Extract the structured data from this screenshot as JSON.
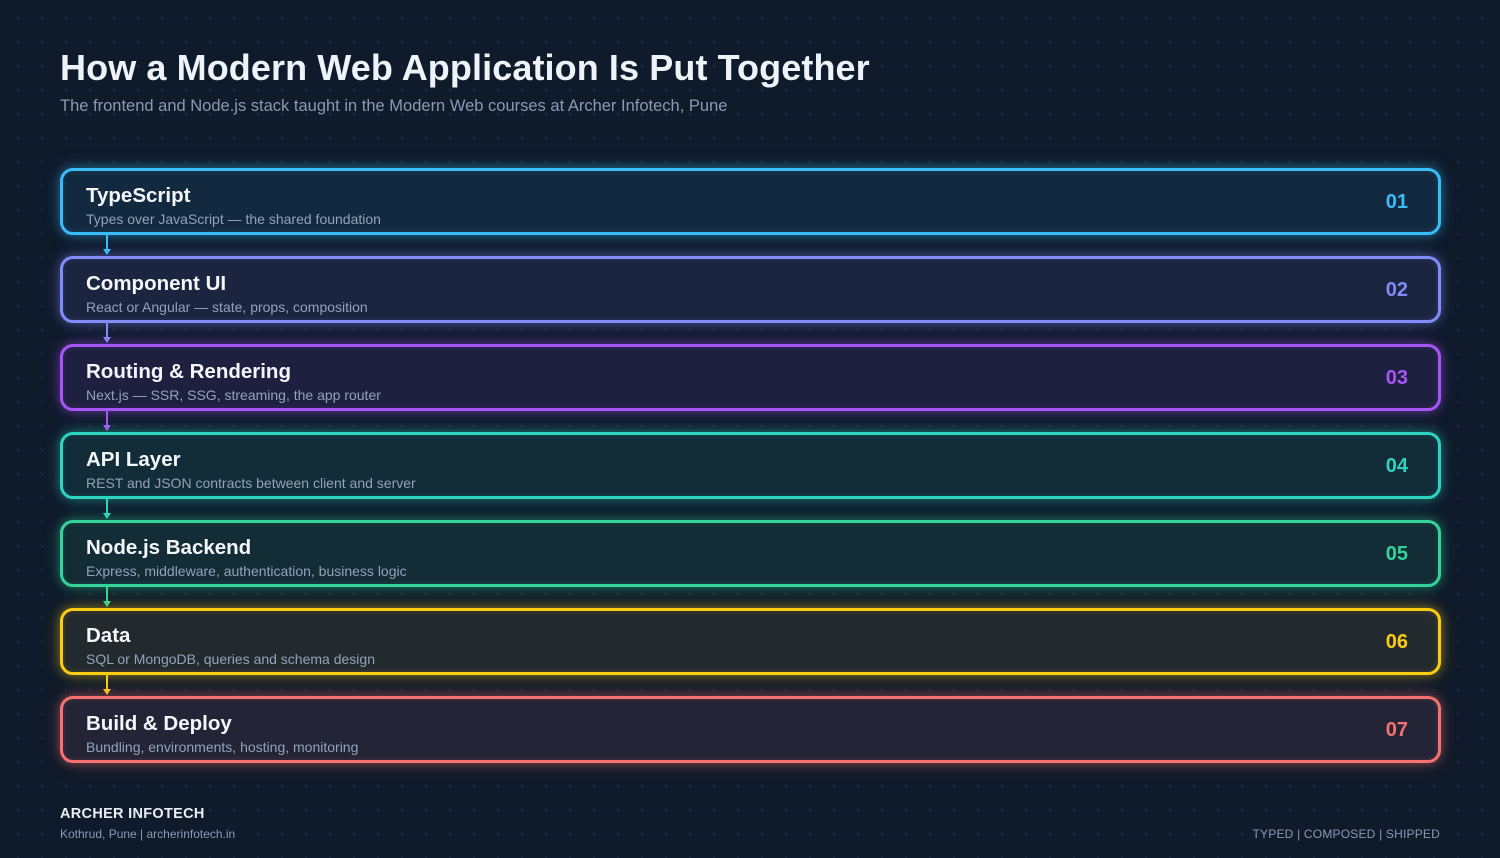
{
  "header": {
    "title": "How a Modern Web Application Is Put Together",
    "subtitle": "The frontend and Node.js stack taught in the Modern Web courses at Archer Infotech, Pune"
  },
  "layers": [
    {
      "name": "TypeScript",
      "desc": "Types over JavaScript — the shared foundation",
      "num": "01",
      "color": "#38bdf8",
      "bg": "#13293f"
    },
    {
      "name": "Component UI",
      "desc": "React or Angular — state, props, composition",
      "num": "02",
      "color": "#818cf8",
      "bg": "#1b2540"
    },
    {
      "name": "Routing & Rendering",
      "desc": "Next.js — SSR, SSG, streaming, the app router",
      "num": "03",
      "color": "#a855f7",
      "bg": "#1e203f"
    },
    {
      "name": "API Layer",
      "desc": "REST and JSON contracts between client and server",
      "num": "04",
      "color": "#2dd4bf",
      "bg": "#122c38"
    },
    {
      "name": "Node.js Backend",
      "desc": "Express, middleware, authentication, business logic",
      "num": "05",
      "color": "#34d399",
      "bg": "#132c35"
    },
    {
      "name": "Data",
      "desc": "SQL or MongoDB, queries and schema design",
      "num": "06",
      "color": "#facc15",
      "bg": "#232a2e"
    },
    {
      "name": "Build & Deploy",
      "desc": "Bundling, environments, hosting, monitoring",
      "num": "07",
      "color": "#f87171",
      "bg": "#232537"
    }
  ],
  "footer": {
    "brand": "ARCHER INFOTECH",
    "contact": "Kothrud, Pune  |  archerinfotech.in",
    "tags": "TYPED  |  COMPOSED  |  SHIPPED"
  }
}
